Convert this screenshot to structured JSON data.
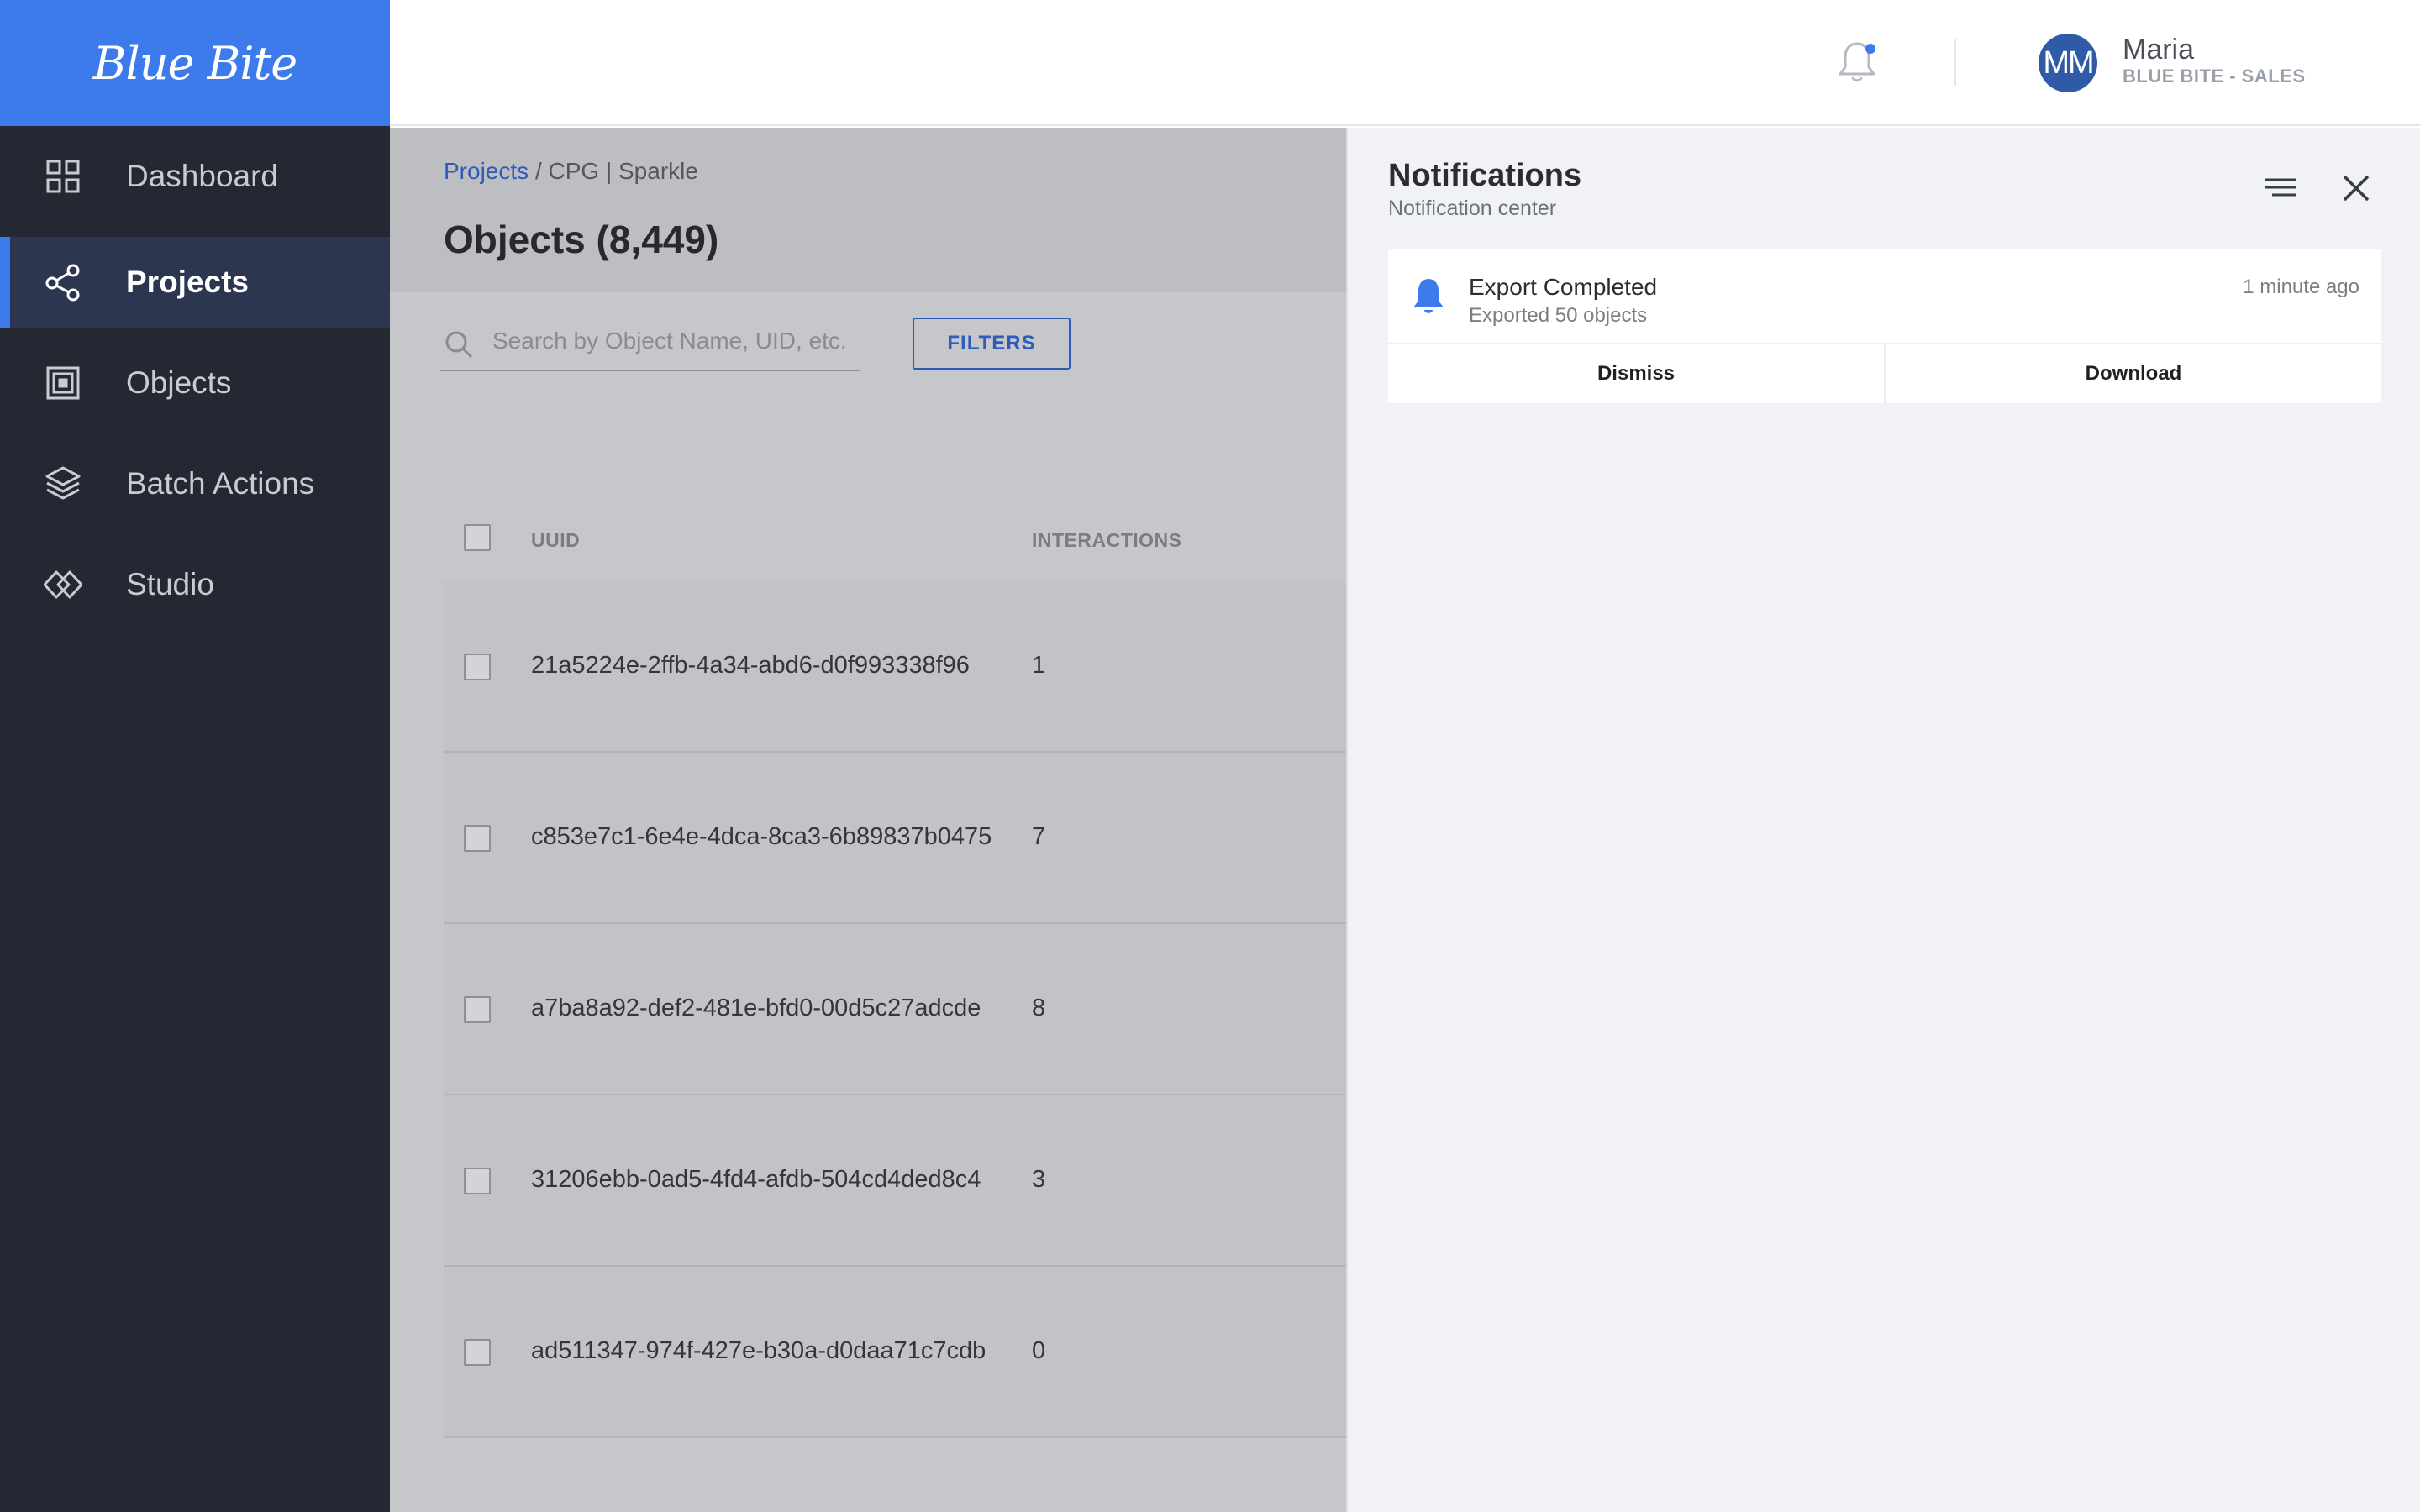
{
  "brand": {
    "logo_text": "Blue Bite",
    "accent": "#3d7aeb",
    "sidebar_bg": "#232833"
  },
  "sidebar": {
    "items": [
      {
        "label": "Dashboard",
        "icon": "grid-icon",
        "active": false
      },
      {
        "label": "Projects",
        "icon": "share-nodes-icon",
        "active": true
      },
      {
        "label": "Objects",
        "icon": "object-frame-icon",
        "active": false
      },
      {
        "label": "Batch Actions",
        "icon": "layers-icon",
        "active": false
      },
      {
        "label": "Studio",
        "icon": "studio-diamond-icon",
        "active": false
      }
    ]
  },
  "header": {
    "bell_icon": "bell-icon",
    "user": {
      "initials": "MM",
      "name": "Maria",
      "org": "BLUE BITE - SALES"
    }
  },
  "main": {
    "breadcrumb": {
      "link": "Projects",
      "separator": "/",
      "current": "CPG | Sparkle"
    },
    "title": "Objects (8,449)",
    "search": {
      "placeholder": "Search by Object Name, UID, etc.",
      "value": ""
    },
    "filters_label": "FILTERS",
    "table": {
      "columns": [
        "UUID",
        "INTERACTIONS"
      ],
      "rows": [
        {
          "uuid": "21a5224e-2ffb-4a34-abd6-d0f993338f96",
          "interactions": "1"
        },
        {
          "uuid": "c853e7c1-6e4e-4dca-8ca3-6b89837b0475",
          "interactions": "7"
        },
        {
          "uuid": "a7ba8a92-def2-481e-bfd0-00d5c27adcde",
          "interactions": "8"
        },
        {
          "uuid": "31206ebb-0ad5-4fd4-afdb-504cd4ded8c4",
          "interactions": "3"
        },
        {
          "uuid": "ad511347-974f-427e-b30a-d0daa71c7cdb",
          "interactions": "0"
        }
      ]
    }
  },
  "notifications": {
    "title": "Notifications",
    "subtitle": "Notification center",
    "items": [
      {
        "title": "Export Completed",
        "detail": "Exported 50 objects",
        "time": "1 minute ago",
        "actions": [
          "Dismiss",
          "Download"
        ]
      }
    ]
  }
}
